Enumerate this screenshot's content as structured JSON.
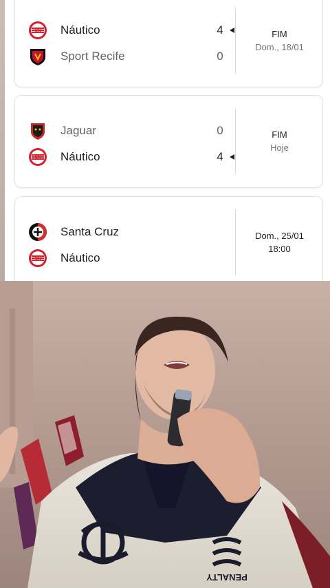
{
  "matches": [
    {
      "team1": {
        "name": "Náutico",
        "score": "4"
      },
      "team2": {
        "name": "Sport Recife",
        "score": "0"
      },
      "status": "FIM",
      "date": "Dom., 18/01"
    },
    {
      "team1": {
        "name": "Jaguar",
        "score": "0"
      },
      "team2": {
        "name": "Náutico",
        "score": "4"
      },
      "status": "FIM",
      "date": "Hoje"
    },
    {
      "team1": {
        "name": "Santa Cruz",
        "score": ""
      },
      "team2": {
        "name": "Náutico",
        "score": ""
      },
      "status": "Dom., 25/01",
      "date": "18:00"
    }
  ],
  "colors": {
    "nautico_red": "#d81e2c",
    "sport_red": "#c8102e",
    "sport_black": "#111111",
    "jaguar_red": "#c62828",
    "santa_cruz_black": "#111111",
    "divider": "#dadce0"
  },
  "jersey": {
    "brand": "PENALTY"
  }
}
